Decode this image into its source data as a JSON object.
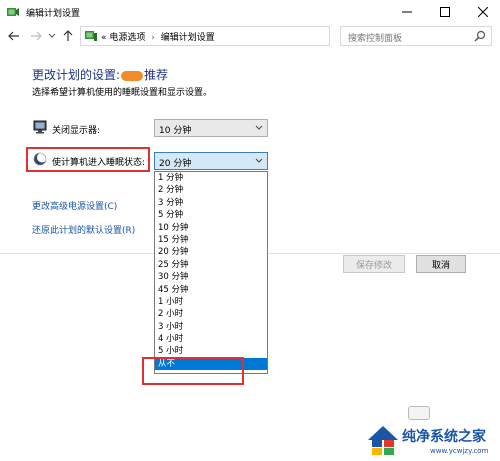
{
  "window": {
    "title": "编辑计划设置",
    "controls": {
      "minimize": "—",
      "maximize": "☐",
      "close": "✕"
    }
  },
  "address": {
    "prefix": "«",
    "crumbs": [
      "电源选项",
      "编辑计划设置"
    ],
    "separator": "›"
  },
  "search": {
    "placeholder": "搜索控制面板"
  },
  "header": {
    "title_prefix": "更改计划的设置:",
    "title_suffix": "推荐",
    "subtitle": "选择希望计算机使用的睡眠设置和显示设置。"
  },
  "settings": {
    "display_off": {
      "label": "关闭显示器:",
      "value": "10 分钟",
      "icon": "monitor-icon"
    },
    "sleep": {
      "label": "使计算机进入睡眠状态:",
      "value": "20 分钟",
      "icon": "moon-icon"
    }
  },
  "dropdown_options": [
    "1 分钟",
    "2 分钟",
    "3 分钟",
    "5 分钟",
    "10 分钟",
    "15 分钟",
    "20 分钟",
    "25 分钟",
    "30 分钟",
    "45 分钟",
    "1 小时",
    "2 小时",
    "3 小时",
    "4 小时",
    "5 小时",
    "从不"
  ],
  "dropdown_selected_index": 15,
  "links": {
    "advanced": "更改高级电源设置(C)",
    "restore": "还原此计划的默认设置(R)"
  },
  "buttons": {
    "save": "保存修改",
    "cancel": "取消"
  },
  "watermark": {
    "text": "纯净系统之家",
    "url": "www.ycwjzy.com"
  },
  "colors": {
    "title_blue": "#1e3287",
    "link_blue": "#1a55a6",
    "highlight_red": "#e03030",
    "selection_blue": "#0078d7",
    "brand_orange": "#f28c28"
  }
}
